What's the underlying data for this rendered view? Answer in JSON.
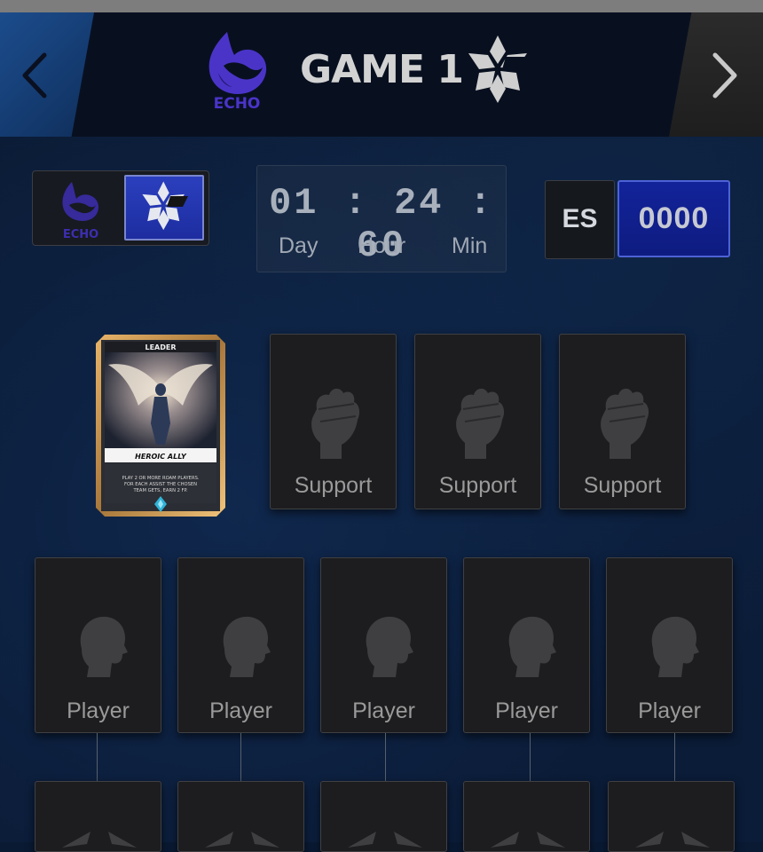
{
  "header": {
    "title": "GAME 1",
    "team_a_logo_text": "ECHO",
    "prev_icon": "chevron-left-icon",
    "next_icon": "chevron-right-icon"
  },
  "teams": {
    "team_a": {
      "name": "ECHO",
      "icon": "orca-logo"
    },
    "team_b": {
      "icon": "star-shield-logo",
      "selected": true
    }
  },
  "timer": {
    "value": "01 : 24 : 60",
    "labels": {
      "day": "Day",
      "hour": "Hour",
      "min": "Min"
    }
  },
  "language": {
    "label": "ES"
  },
  "score": {
    "value": "0000"
  },
  "leader_card": {
    "badge": "LEADER",
    "name": "HEROIC ALLY",
    "description_line1": "PLAY 2 OR MORE ROAM PLAYERS.",
    "description_line2": "FOR EACH ASSIST THE CHOSEN",
    "description_line3": "TEAM GETS, EARN 2 FP."
  },
  "support_slots": [
    {
      "label": "Support",
      "icon": "fist-icon"
    },
    {
      "label": "Support",
      "icon": "fist-icon"
    },
    {
      "label": "Support",
      "icon": "fist-icon"
    }
  ],
  "player_slots": [
    {
      "label": "Player",
      "icon": "head-icon"
    },
    {
      "label": "Player",
      "icon": "head-icon"
    },
    {
      "label": "Player",
      "icon": "head-icon"
    },
    {
      "label": "Player",
      "icon": "head-icon"
    },
    {
      "label": "Player",
      "icon": "head-icon"
    }
  ],
  "colors": {
    "background": "#0a1a33",
    "accent_blue": "#1d2da0",
    "slot_bg": "#1d1d1f",
    "echo_purple": "#4a34c8"
  }
}
